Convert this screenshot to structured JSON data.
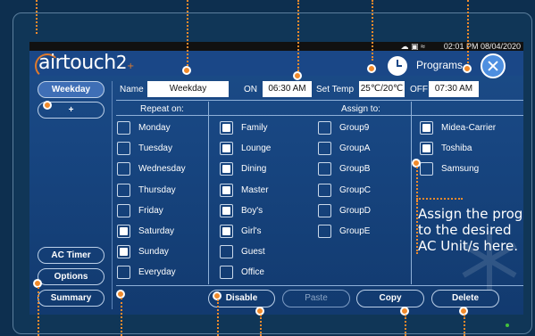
{
  "status_bar": {
    "icons": "☁ ▣ ≈",
    "time": "02:01 PM 08/04/2020"
  },
  "header": {
    "logo_main": "airtouch",
    "logo_suffix": "2",
    "logo_plus": "+",
    "programs_label": "Programs"
  },
  "sidebar": {
    "weekday_tab": "Weekday",
    "add_tab": "+",
    "ac_timer": "AC Timer",
    "options": "Options",
    "summary": "Summary"
  },
  "form": {
    "name_label": "Name",
    "name_value": "Weekday",
    "on_label": "ON",
    "on_value": "06:30 AM",
    "set_temp_label": "Set Temp",
    "set_temp_value": "25℃/20℃",
    "off_label": "OFF",
    "off_value": "07:30 AM"
  },
  "repeat": {
    "title": "Repeat on:",
    "days": [
      {
        "label": "Monday",
        "checked": false
      },
      {
        "label": "Tuesday",
        "checked": false
      },
      {
        "label": "Wednesday",
        "checked": false
      },
      {
        "label": "Thursday",
        "checked": false
      },
      {
        "label": "Friday",
        "checked": false
      },
      {
        "label": "Saturday",
        "checked": true
      },
      {
        "label": "Sunday",
        "checked": true
      },
      {
        "label": "Everyday",
        "checked": false
      }
    ]
  },
  "assign": {
    "title": "Assign to:",
    "zones_col1": [
      {
        "label": "Family",
        "checked": true
      },
      {
        "label": "Lounge",
        "checked": true
      },
      {
        "label": "Dining",
        "checked": true
      },
      {
        "label": "Master",
        "checked": true
      },
      {
        "label": "Boy's",
        "checked": true
      },
      {
        "label": "Girl's",
        "checked": true
      },
      {
        "label": "Guest",
        "checked": false
      },
      {
        "label": "Office",
        "checked": false
      }
    ],
    "zones_col2": [
      {
        "label": "Group9",
        "checked": false
      },
      {
        "label": "GroupA",
        "checked": false
      },
      {
        "label": "GroupB",
        "checked": false
      },
      {
        "label": "GroupC",
        "checked": false
      },
      {
        "label": "GroupD",
        "checked": false
      },
      {
        "label": "GroupE",
        "checked": false
      }
    ],
    "ac_units": [
      {
        "label": "Midea-Carrier",
        "checked": true
      },
      {
        "label": "Toshiba",
        "checked": true
      },
      {
        "label": "Samsung",
        "checked": false
      }
    ]
  },
  "actions": {
    "disable": "Disable",
    "paste": "Paste",
    "copy": "Copy",
    "delete": "Delete"
  },
  "annotation": {
    "line1": "Assign the prog",
    "line2": "to the desired",
    "line3": "AC Unit/s here.",
    "accent_color": "#f08a2b"
  }
}
